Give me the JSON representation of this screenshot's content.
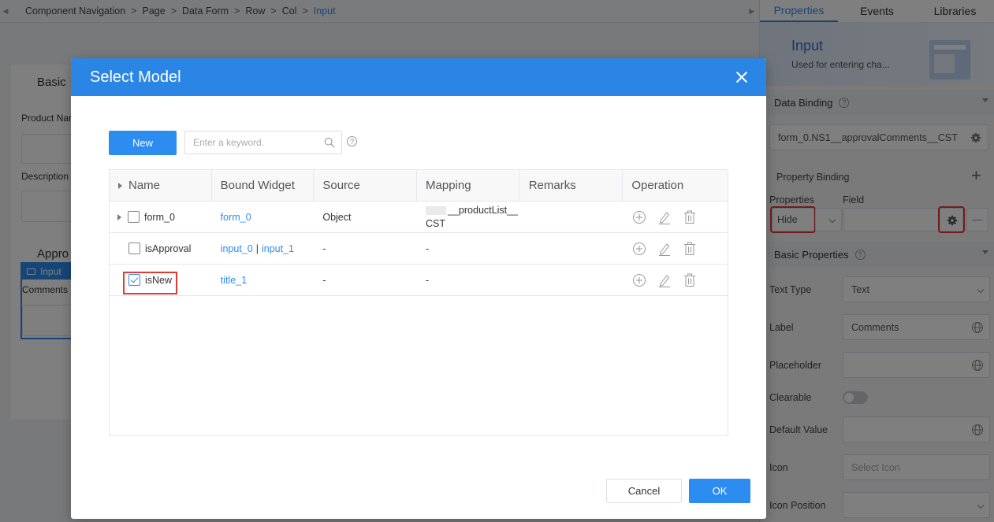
{
  "breadcrumb": [
    "Component Navigation",
    "Page",
    "Data Form",
    "Row",
    "Col",
    "Input"
  ],
  "background": {
    "section_basic": "Basic",
    "product_name_label": "Product Nar",
    "description_label": "Description",
    "approval_heading": "Appro",
    "input_tag": "Input",
    "comments_label": "Comments"
  },
  "right_panel": {
    "tabs": [
      "Properties",
      "Events",
      "Libraries"
    ],
    "component_title": "Input",
    "component_desc": "Used for entering cha...",
    "data_binding_title": "Data Binding",
    "data_binding_value": "form_0.NS1__approvalComments__CST",
    "property_binding_title": "Property Binding",
    "properties_col": "Properties",
    "field_col": "Field",
    "properties_value": "Hide",
    "basic_properties_title": "Basic Properties",
    "text_type_label": "Text Type",
    "text_type_value": "Text",
    "label_label": "Label",
    "label_value": "Comments",
    "placeholder_label": "Placeholder",
    "clearable_label": "Clearable",
    "default_value_label": "Default Value",
    "icon_label": "Icon",
    "icon_placeholder": "Select Icon",
    "icon_position_label": "Icon Position"
  },
  "modal": {
    "title": "Select Model",
    "new_button": "New",
    "search_placeholder": "Enter a keyword.",
    "columns": [
      "Name",
      "Bound Widget",
      "Source",
      "Mapping",
      "Remarks",
      "Operation"
    ],
    "rows": [
      {
        "name": "form_0",
        "widget": "form_0",
        "source": "Object",
        "mapping_line1": "__productList__",
        "mapping_line2": "CST",
        "checked": false,
        "expandable": true
      },
      {
        "name": "isApproval",
        "widget1": "input_0",
        "widget_sep": "|",
        "widget2": "input_1",
        "source": "-",
        "mapping": "-",
        "checked": false
      },
      {
        "name": "isNew",
        "widget": "title_1",
        "source": "-",
        "mapping": "-",
        "checked": true
      }
    ],
    "cancel_button": "Cancel",
    "ok_button": "OK"
  },
  "colors": {
    "primary": "#2d8cf0",
    "header": "#2b85e4",
    "highlight": "#e53935"
  }
}
